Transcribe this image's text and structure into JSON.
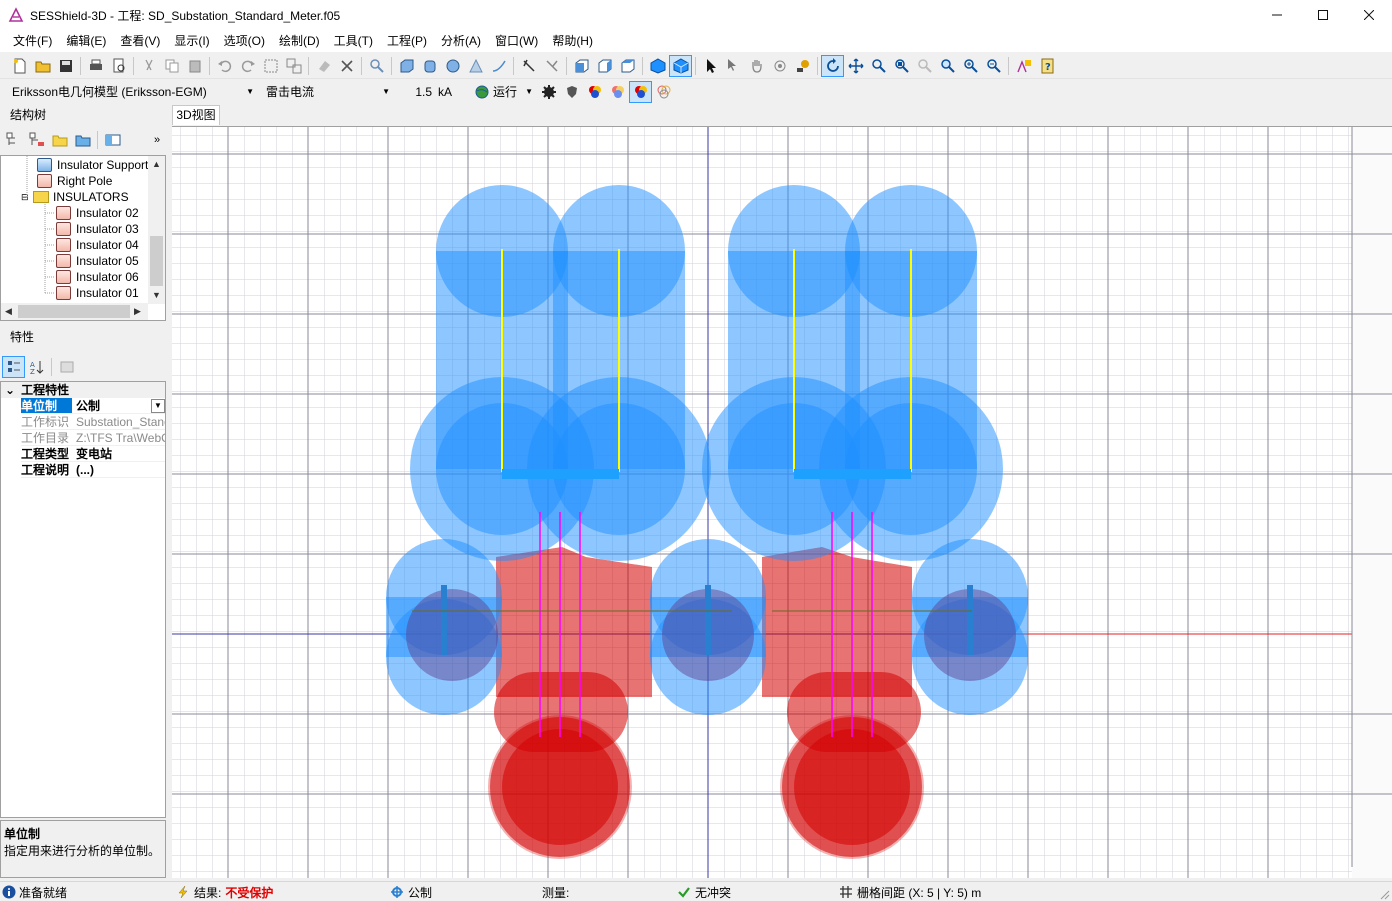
{
  "window": {
    "title": "SESShield-3D - 工程: SD_Substation_Standard_Meter.f05"
  },
  "menu": [
    "文件(F)",
    "编辑(E)",
    "查看(V)",
    "显示(I)",
    "选项(O)",
    "绘制(D)",
    "工具(T)",
    "工程(P)",
    "分析(A)",
    "窗口(W)",
    "帮助(H)"
  ],
  "toolbar2": {
    "model_select": "Eriksson电几何模型 (Eriksson-EGM)",
    "type_select": "雷击电流",
    "current_value": "1.5",
    "current_unit": "kA",
    "run_label": "运行"
  },
  "structure_panel": {
    "title": "结构树",
    "items": [
      {
        "label": "Insulator Support",
        "icon": "blue"
      },
      {
        "label": "Right Pole",
        "icon": "red"
      },
      {
        "label": "INSULATORS",
        "icon": "folder"
      },
      {
        "label": "Insulator 02",
        "icon": "red"
      },
      {
        "label": "Insulator 03",
        "icon": "red"
      },
      {
        "label": "Insulator 04",
        "icon": "red"
      },
      {
        "label": "Insulator 05",
        "icon": "red"
      },
      {
        "label": "Insulator 06",
        "icon": "red"
      },
      {
        "label": "Insulator 01",
        "icon": "red"
      }
    ]
  },
  "properties_panel": {
    "title": "特性",
    "category": "工程特性",
    "rows": [
      {
        "key": "单位制",
        "value": "公制",
        "style": "selected"
      },
      {
        "key": "工作标识",
        "value": "Substation_Standa",
        "style": "dim"
      },
      {
        "key": "工作目录",
        "value": "Z:\\TFS Tra\\WebC",
        "style": "dim"
      },
      {
        "key": "工程类型",
        "value": "变电站",
        "style": "bold"
      },
      {
        "key": "工程说明",
        "value": "(...)",
        "style": "bold"
      }
    ],
    "description_title": "单位制",
    "description_text": "指定用来进行分析的单位制。"
  },
  "view": {
    "tab_label": "3D视图"
  },
  "status": {
    "ready": "准备就绪",
    "result_label": "结果:",
    "result_value": "不受保护",
    "units": "公制",
    "measure": "测量:",
    "conflict": "无冲突",
    "grid": "栅格间距 (X: 5 | Y: 5) m"
  },
  "colors": {
    "shield_blue": "#1e90ff",
    "zone_red": "#d40000",
    "status_red": "#e00000",
    "selection": "#0078d7"
  }
}
